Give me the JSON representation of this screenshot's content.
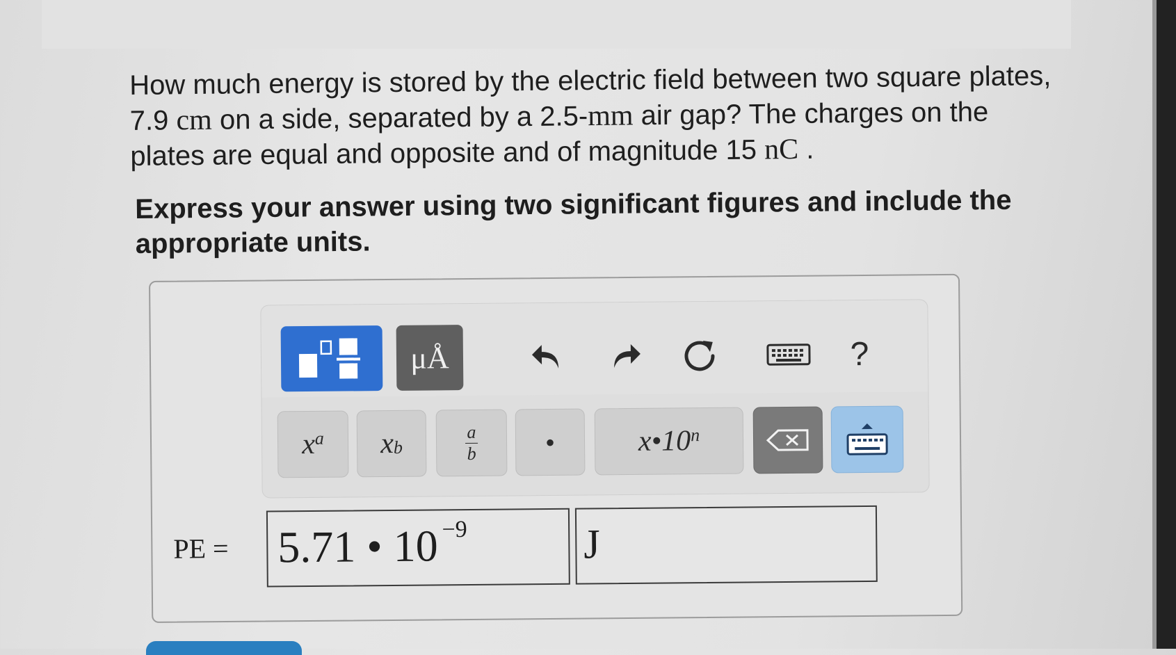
{
  "question": {
    "line1": "How much energy is stored by the electric field between two square plates,",
    "line2_a": "7.9",
    "line2_unit1": "cm",
    "line2_b": "on a side, separated by a 2.5-",
    "line2_unit2": "mm",
    "line2_c": "air gap? The charges on the",
    "line3_a": "plates are equal and opposite and of magnitude 15",
    "line3_unit": "nC",
    "line3_b": "."
  },
  "instruction": "Express your answer using two significant figures and include the appropriate units.",
  "toolbar": {
    "units_label": "μÅ",
    "help_label": "?"
  },
  "keys": {
    "sup_base": "x",
    "sup_exp": "a",
    "sub_base": "x",
    "sub_idx": "b",
    "frac_num": "a",
    "frac_den": "b",
    "dot": "•",
    "sci": "x•10",
    "sci_exp": "n"
  },
  "answer": {
    "label": "PE =",
    "value_mantissa": "5.71 • 10",
    "value_exponent": "−9",
    "unit": "J"
  }
}
